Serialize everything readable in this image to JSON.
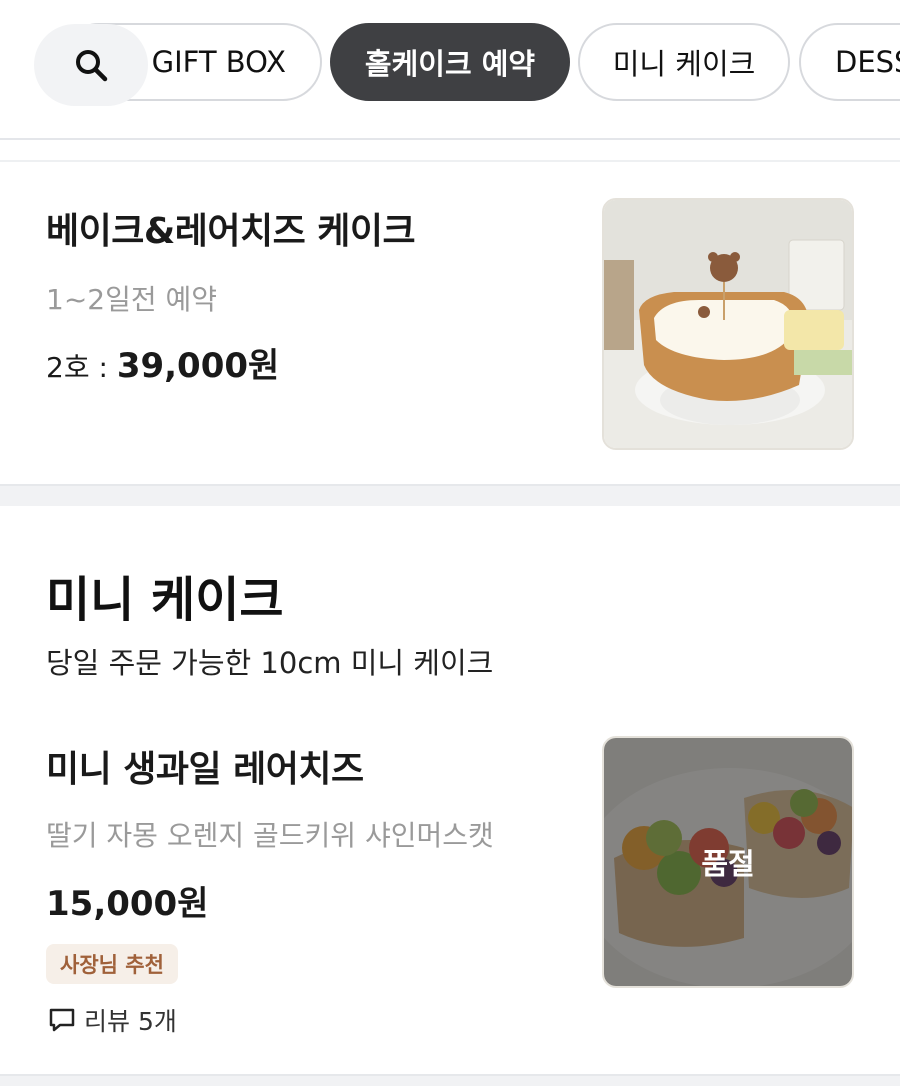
{
  "categories": [
    {
      "label": "GIFT BOX",
      "active": false
    },
    {
      "label": "홀케이크 예약",
      "active": true
    },
    {
      "label": "미니 케이크",
      "active": false
    },
    {
      "label": "DESSERT",
      "active": false
    }
  ],
  "items": [
    {
      "title": "베이크&레어치즈 케이크",
      "subtitle": "1~2일전 예약",
      "price_prefix": "2호 : ",
      "price": "39,000원",
      "image_icon": "bear-cheesecake-photo"
    }
  ],
  "section": {
    "title": "미니 케이크",
    "description": "당일 주문 가능한 10cm 미니 케이크",
    "items": [
      {
        "title": "미니 생과일 레어치즈",
        "subtitle": "딸기 자몽 오렌지 골드키위 샤인머스캣",
        "price": "15,000원",
        "badge": "사장님 추천",
        "review_label": "리뷰 5개",
        "soldout_label": "품절",
        "image_icon": "fruit-tart-photo"
      }
    ]
  }
}
